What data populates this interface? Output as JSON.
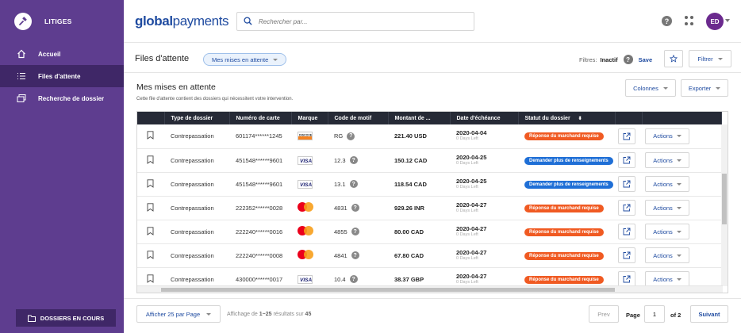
{
  "sidebar": {
    "title": "LITIGES",
    "items": [
      {
        "label": "Accueil",
        "icon": "home-icon"
      },
      {
        "label": "Files d'attente",
        "icon": "list-icon",
        "active": true
      },
      {
        "label": "Recherche de dossier",
        "icon": "folders-icon"
      }
    ],
    "footer_label": "DOSSIERS EN COURS"
  },
  "topbar": {
    "brand_bold": "global",
    "brand_light": "payments",
    "search_placeholder": "Rechercher par...",
    "help_label": "?",
    "avatar": "ED"
  },
  "queue": {
    "title": "Files d'attente",
    "selected_queue": "Mes mises en attente",
    "filters_label": "Filtres:",
    "filters_value": "Inactif",
    "save_label": "Save",
    "filter_button": "Filtrer"
  },
  "section": {
    "title": "Mes mises en attente",
    "subtitle": "Cette file d'attente contient des dossiers qui nécessitent votre intervention.",
    "columns_button": "Colonnes",
    "export_button": "Exporter"
  },
  "table": {
    "headers": [
      "",
      "Type de dossier",
      "Numéro de carte",
      "Marque",
      "Code de motif",
      "Montant de ...",
      "Date d'échéance",
      "Statut du dossier",
      "",
      ""
    ],
    "rows": [
      {
        "type": "Contrepassation",
        "card": "601174******1245",
        "brand": "discover",
        "reason": "RG",
        "amount": "221.40 USD",
        "due": "2020-04-04",
        "left": "0 Days Left",
        "status": "Réponse du marchand requise",
        "status_color": "orange",
        "action": "Actions"
      },
      {
        "type": "Contrepassation",
        "card": "451548******9601",
        "brand": "visa",
        "reason": "12.3",
        "amount": "150.12 CAD",
        "due": "2020-04-25",
        "left": "0 Days Left",
        "status": "Demander plus de renseignements",
        "status_color": "blue",
        "action": "Actions"
      },
      {
        "type": "Contrepassation",
        "card": "451548******9601",
        "brand": "visa",
        "reason": "13.1",
        "amount": "118.54 CAD",
        "due": "2020-04-25",
        "left": "0 Days Left",
        "status": "Demander plus de renseignements",
        "status_color": "blue",
        "action": "Actions"
      },
      {
        "type": "Contrepassation",
        "card": "222352******0028",
        "brand": "mastercard",
        "reason": "4831",
        "amount": "929.26 INR",
        "due": "2020-04-27",
        "left": "0 Days Left",
        "status": "Réponse du marchand requise",
        "status_color": "orange",
        "action": "Actions"
      },
      {
        "type": "Contrepassation",
        "card": "222240******0016",
        "brand": "mastercard",
        "reason": "4855",
        "amount": "80.00 CAD",
        "due": "2020-04-27",
        "left": "0 Days Left",
        "status": "Réponse du marchand requise",
        "status_color": "orange",
        "action": "Actions"
      },
      {
        "type": "Contrepassation",
        "card": "222240******0008",
        "brand": "mastercard",
        "reason": "4841",
        "amount": "67.80 CAD",
        "due": "2020-04-27",
        "left": "0 Days Left",
        "status": "Réponse du marchand requise",
        "status_color": "orange",
        "action": "Actions"
      },
      {
        "type": "Contrepassation",
        "card": "430000******0017",
        "brand": "visa",
        "reason": "10.4",
        "amount": "38.37 GBP",
        "due": "2020-04-27",
        "left": "0 Days Left",
        "status": "Réponse du marchand requise",
        "status_color": "orange",
        "action": "Actions"
      }
    ]
  },
  "footer": {
    "per_page": "Afficher 25 par Page",
    "showing_prefix": "Affichage de ",
    "showing_range": "1~25",
    "showing_mid": " résultats sur ",
    "showing_total": "45",
    "prev": "Prev",
    "page_label": "Page",
    "page_value": "1",
    "of_label": "of 2",
    "next": "Suivant"
  },
  "colors": {
    "sidebar": "#5e3d8f",
    "sidebar_active": "#3f2767",
    "accent": "#1f4ba0",
    "orange": "#f05a22",
    "blue": "#1f6fd6"
  }
}
